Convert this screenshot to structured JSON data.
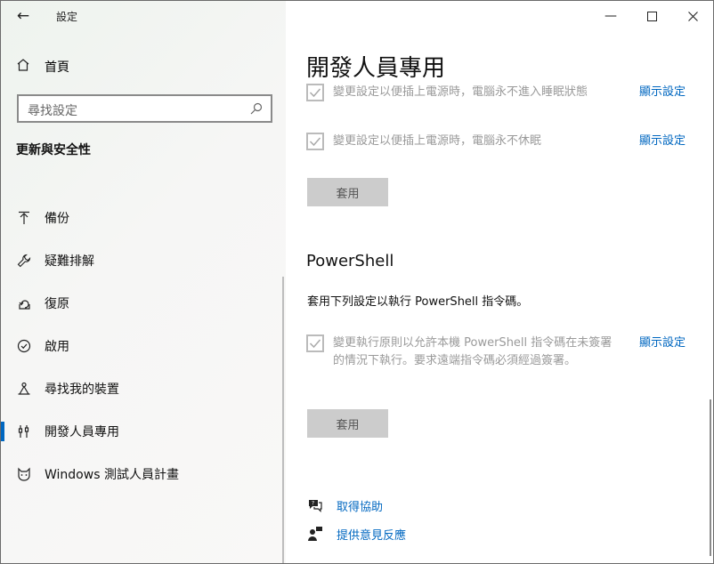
{
  "titlebar": {
    "app_title": "設定"
  },
  "sidebar": {
    "home_label": "首頁",
    "search_placeholder": "尋找設定",
    "section_title": "更新與安全性",
    "items": [
      {
        "label": "備份",
        "icon": "backup-arrow-icon"
      },
      {
        "label": "疑難排解",
        "icon": "wrench-icon"
      },
      {
        "label": "復原",
        "icon": "recovery-icon"
      },
      {
        "label": "啟用",
        "icon": "check-circle-icon"
      },
      {
        "label": "尋找我的裝置",
        "icon": "find-device-icon"
      },
      {
        "label": "開發人員專用",
        "icon": "developer-tools-icon",
        "active": true
      },
      {
        "label": "Windows 測試人員計畫",
        "icon": "insider-cat-icon"
      }
    ]
  },
  "main": {
    "page_title": "開發人員專用",
    "power_rows": [
      {
        "text": "變更設定以便插上電源時，電腦永不進入睡眠狀態",
        "link": "顯示設定"
      },
      {
        "text": "變更設定以便插上電源時，電腦永不休眠",
        "link": "顯示設定"
      }
    ],
    "apply_label": "套用",
    "powershell": {
      "heading": "PowerShell",
      "description": "套用下列設定以執行 PowerShell 指令碼。",
      "row_text": "變更執行原則以允許本機 PowerShell 指令碼在未簽署的情況下執行。要求遠端指令碼必須經過簽署。",
      "row_link": "顯示設定",
      "apply_label": "套用"
    },
    "help": {
      "get_help": "取得協助",
      "feedback": "提供意見反應"
    }
  },
  "colors": {
    "accent": "#0067c0",
    "disabled_text": "#9a9a9a",
    "button_bg": "#cccccc"
  }
}
